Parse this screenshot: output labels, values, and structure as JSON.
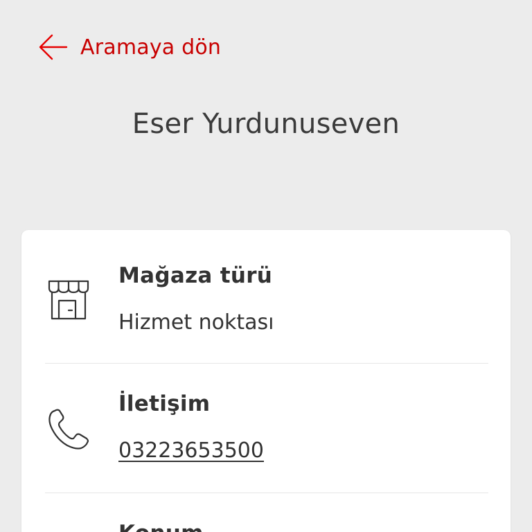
{
  "header": {
    "back_label": "Aramaya dön",
    "back_icon": "arrow-left-icon"
  },
  "store": {
    "name": "Eser Yurdunuseven"
  },
  "details": {
    "store_type": {
      "icon": "storefront-icon",
      "title": "Mağaza türü",
      "value": "Hizmet noktası"
    },
    "contact": {
      "icon": "phone-icon",
      "title": "İletişim",
      "value": "03223653500"
    },
    "location": {
      "title": "Konum"
    }
  },
  "colors": {
    "accent": "#e60000",
    "background": "#ececec",
    "card": "#ffffff",
    "text": "#333333"
  }
}
